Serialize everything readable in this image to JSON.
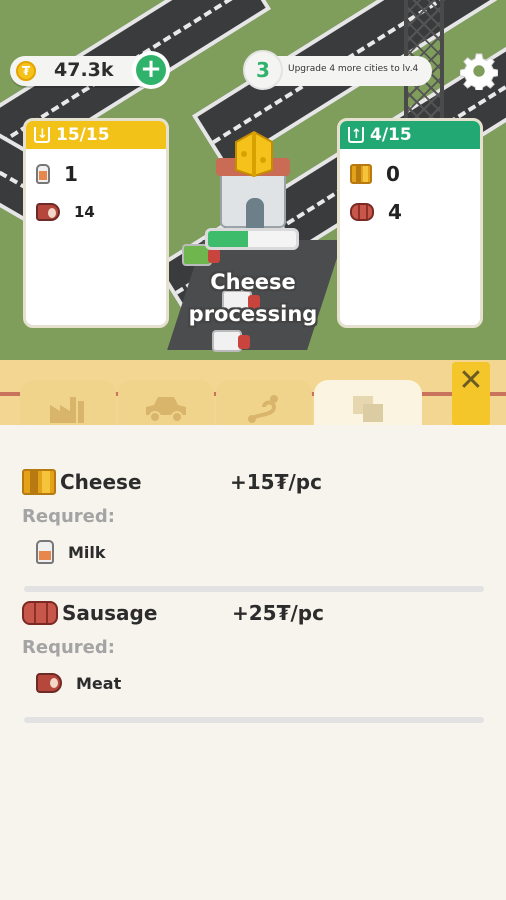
{
  "hud": {
    "coin_balance": "47.3k",
    "city_level": "3",
    "level_hint": "Upgrade 4 more cities to lv.4"
  },
  "input_storage": {
    "header": "15/15",
    "items": [
      {
        "icon": "milk-icon",
        "count": "1"
      },
      {
        "icon": "meat-icon",
        "count": "14"
      }
    ]
  },
  "output_storage": {
    "header": "4/15",
    "items": [
      {
        "icon": "cheese-icon",
        "count": "0"
      },
      {
        "icon": "sausage-icon",
        "count": "4"
      }
    ]
  },
  "factory": {
    "status_line1": "Cheese",
    "status_line2": "processing",
    "progress": 0.45
  },
  "tabs": [
    {
      "name": "factory-icon",
      "active": false
    },
    {
      "name": "truck-icon",
      "active": false
    },
    {
      "name": "route-icon",
      "active": false
    },
    {
      "name": "recipes-icon",
      "active": true
    }
  ],
  "recipes": [
    {
      "name": "Cheese",
      "price": "+15₮/pc",
      "required_label": "Requred:",
      "required": "Milk"
    },
    {
      "name": "Sausage",
      "price": "+25₮/pc",
      "required_label": "Requred:",
      "required": "Meat"
    }
  ],
  "colors": {
    "accent_green": "#2fb36a",
    "input_header": "#f3c218",
    "output_header": "#22a873",
    "panel_tab": "#f0d48c"
  }
}
